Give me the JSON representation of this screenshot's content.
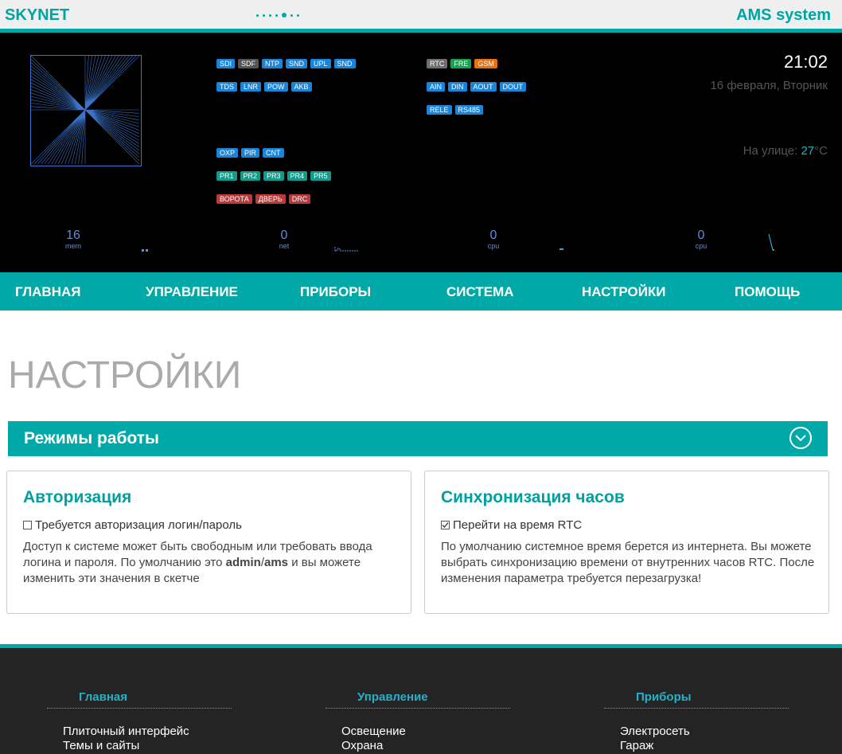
{
  "header": {
    "brand": "SKYNET",
    "system": "AMS system"
  },
  "dashboard": {
    "badges_col1": [
      [
        {
          "label": "SDI",
          "color": "#1a84d8"
        },
        {
          "label": "SDF",
          "color": "#555555"
        },
        {
          "label": "NTP",
          "color": "#1a84d8"
        },
        {
          "label": "SND",
          "color": "#1a84d8"
        },
        {
          "label": "UPL",
          "color": "#1a84d8"
        },
        {
          "label": "SND",
          "color": "#1a84d8"
        }
      ],
      [
        {
          "label": "TDS",
          "color": "#1a84d8"
        },
        {
          "label": "LNR",
          "color": "#1a84d8"
        },
        {
          "label": "POW",
          "color": "#1a84d8"
        },
        {
          "label": "AKB",
          "color": "#1a84d8"
        }
      ],
      [
        {
          "label": "OXP",
          "color": "#1a84d8"
        },
        {
          "label": "PIR",
          "color": "#1a84d8"
        },
        {
          "label": "CNT",
          "color": "#1a84d8"
        }
      ],
      [
        {
          "label": "PR1",
          "color": "#129a8a"
        },
        {
          "label": "PR2",
          "color": "#129a8a"
        },
        {
          "label": "PR3",
          "color": "#129a8a"
        },
        {
          "label": "PR4",
          "color": "#129a8a"
        },
        {
          "label": "PR5",
          "color": "#129a8a"
        }
      ],
      [
        {
          "label": "ВОРОТА",
          "color": "#b83a3a"
        },
        {
          "label": "ДВЕРЬ",
          "color": "#b83a3a"
        },
        {
          "label": "DRC",
          "color": "#b83a3a"
        }
      ]
    ],
    "badges_col2": [
      [
        {
          "label": "RTC",
          "color": "#6e6e6e"
        },
        {
          "label": "FRE",
          "color": "#1aa050"
        },
        {
          "label": "GSM",
          "color": "#e67012"
        }
      ],
      [
        {
          "label": "AIN",
          "color": "#1a84d8"
        },
        {
          "label": "DIN",
          "color": "#1a84d8"
        },
        {
          "label": "AOUT",
          "color": "#1a84d8"
        },
        {
          "label": "DOUT",
          "color": "#1a84d8"
        }
      ],
      [
        {
          "label": "RELE",
          "color": "#1a84d8"
        },
        {
          "label": "RS485",
          "color": "#1a84d8"
        }
      ]
    ],
    "time": "21:02",
    "date": "16 февраля, Вторник",
    "outside_label": "На улице: ",
    "outside_temp": "27",
    "outside_unit": "°C",
    "stats": [
      {
        "value": "16",
        "label": "mem"
      },
      {
        "value": "0",
        "label": "net"
      },
      {
        "value": "0",
        "label": "cpu"
      },
      {
        "value": "0",
        "label": "cpu"
      }
    ]
  },
  "nav": [
    "ГЛАВНАЯ",
    "УПРАВЛЕНИЕ",
    "ПРИБОРЫ",
    "СИСТЕМА",
    "НАСТРОЙКИ",
    "ПОМОЩЬ"
  ],
  "page": {
    "title": "НАСТРОЙКИ"
  },
  "section": {
    "title": "Режимы работы",
    "icon": "chevron-down-icon"
  },
  "cards": [
    {
      "title": "Авторизация",
      "checkbox_label": "Требуется авторизация логин/пароль",
      "checked": false,
      "desc_prefix": "Доступ к системе может быть свободным или требовать ввода логина и пароля. По умолчанию это ",
      "desc_bold1": "admin",
      "desc_sep": "/",
      "desc_bold2": "ams",
      "desc_suffix": " и вы можете изменить эти значения в скетче"
    },
    {
      "title": "Синхронизация часов",
      "checkbox_label": "Перейти на время RTC",
      "checked": true,
      "desc": "По умолчанию системное время берется из интернета. Вы можете выбрать синхронизацию времени от внутренних часов RTC. После изменения параметра требуется перезагрузка!"
    }
  ],
  "footer": {
    "columns": [
      {
        "heading": "Главная",
        "links": [
          "Плиточный интерфейс",
          "Темы и сайты"
        ]
      },
      {
        "heading": "Управление",
        "links": [
          "Освещение",
          "Охрана"
        ]
      },
      {
        "heading": "Приборы",
        "links": [
          "Электросеть",
          "Гараж"
        ]
      }
    ]
  }
}
